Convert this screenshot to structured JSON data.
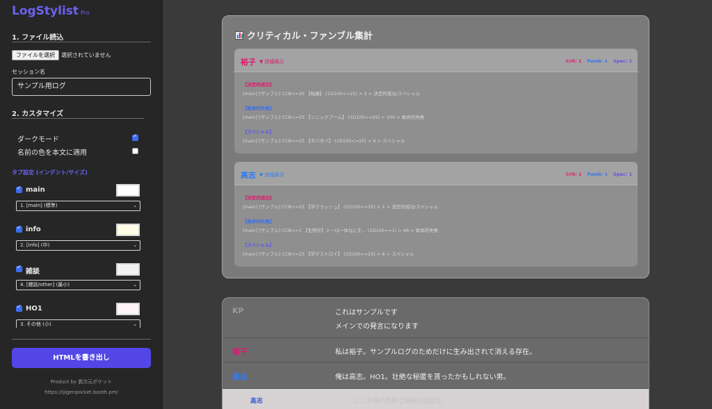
{
  "app": {
    "name": "LogStylist",
    "edition": "Pro"
  },
  "sidebar": {
    "section_file": "1. ファイル読込",
    "file_button": "ファイルを選択",
    "file_status": "選択されていません",
    "session_label": "セッション名",
    "session_value": "サンプル用ログ",
    "section_custom": "2. カスタマイズ",
    "dark_mode_label": "ダークモード",
    "dark_mode_checked": true,
    "name_color_label": "名前の色を本文に適用",
    "name_color_checked": false,
    "tab_settings_title": "タブ設定 (インデント/サイズ)",
    "tabs": [
      {
        "name": "main",
        "checked": true,
        "color": "#ffffff",
        "option": "1. [main] (標準)"
      },
      {
        "name": "info",
        "checked": true,
        "color": "#fffde6",
        "option": "2. [info] (中)"
      },
      {
        "name": "雑談",
        "checked": true,
        "color": "#f2f2f4",
        "option": "4. [雑談/other] (最小)"
      },
      {
        "name": "HO1",
        "checked": true,
        "color": "#fff5f7",
        "option": "3. その他 (小)"
      }
    ],
    "export_button": "HTMLを書き出し",
    "credit_line1": "Product by 異次元ポケット",
    "credit_line2": "https://ijigenpocket.booth.pm/"
  },
  "critical_summary": {
    "title": "クリティカル・ファンブル集計",
    "detail_toggle": "▼ 詳細表示",
    "players": [
      {
        "name": "裕子",
        "name_color": "#e0186b",
        "crit": "Crit: 1",
        "fumb": "Fumb: 1",
        "spec": "Spec: 1",
        "entries": [
          {
            "heading": "【決定的成功】",
            "color": "#e0186b",
            "text": "[main] [サンプル] CCB<=35 【暗躍】 (1D100<=25) > 3 > 決定的成功/スペシャル"
          },
          {
            "heading": "【致命的失敗】",
            "color": "#3a6fe8",
            "text": "[main] [サンプル] CCB<=25 【ソニックブーム】 (1D100<=25) > 100 > 致命的失敗"
          },
          {
            "heading": "【スペシャル】",
            "color": "#5b52e8",
            "text": "[main] [サンプル] CCB<=25 【ダバダバ】 (1D100<=25) > 6 > スペシャル"
          }
        ]
      },
      {
        "name": "高志",
        "name_color": "#2f7cf0",
        "crit": "Crit: 1",
        "fumb": "Fumb: 1",
        "spec": "Spec: 1",
        "entries": [
          {
            "heading": "【決定的成功】",
            "color": "#e0186b",
            "text": "[main] [サンプル] CCB<=25 【学クラッシュ】 (1D100<=25) > 1 > 決定的成功/スペシャル"
          },
          {
            "heading": "【致命的失敗】",
            "color": "#3a6fe8",
            "text": "[main] [サンプル] CCB<=1 【生物学】ミ一は一体なにを... (1D100<=1) > 96 > 致命的失敗"
          },
          {
            "heading": "【スペシャル】",
            "color": "#5b52e8",
            "text": "[main] [サンプル] CCB<=25 【学デストロイ】 (1D100<=25) > 6 > スペシャル"
          }
        ]
      }
    ]
  },
  "log": [
    {
      "name": "KP",
      "color": "#9a9a9a",
      "lines": [
        "これはサンプルです",
        "メインでの発言になります"
      ]
    },
    {
      "name": "裕子",
      "color": "#e0186b",
      "lines": [
        "私は裕子。サンプルログのためだけに生み出されて消える存在。"
      ]
    },
    {
      "name": "高志",
      "color": "#2f7cf0",
      "lines": [
        "俺は高志。HO1。壮絶な秘匿を貰ったかもしれない男。"
      ]
    },
    {
      "name": "高志",
      "color": "#3b5fd4",
      "lines": [
        "ここが俺の壮絶な秘匿の設定だ。"
      ]
    }
  ],
  "colors": {
    "accent": "#5247e6",
    "sidebar_bg": "#262627",
    "main_bg": "#3a3a3b"
  }
}
